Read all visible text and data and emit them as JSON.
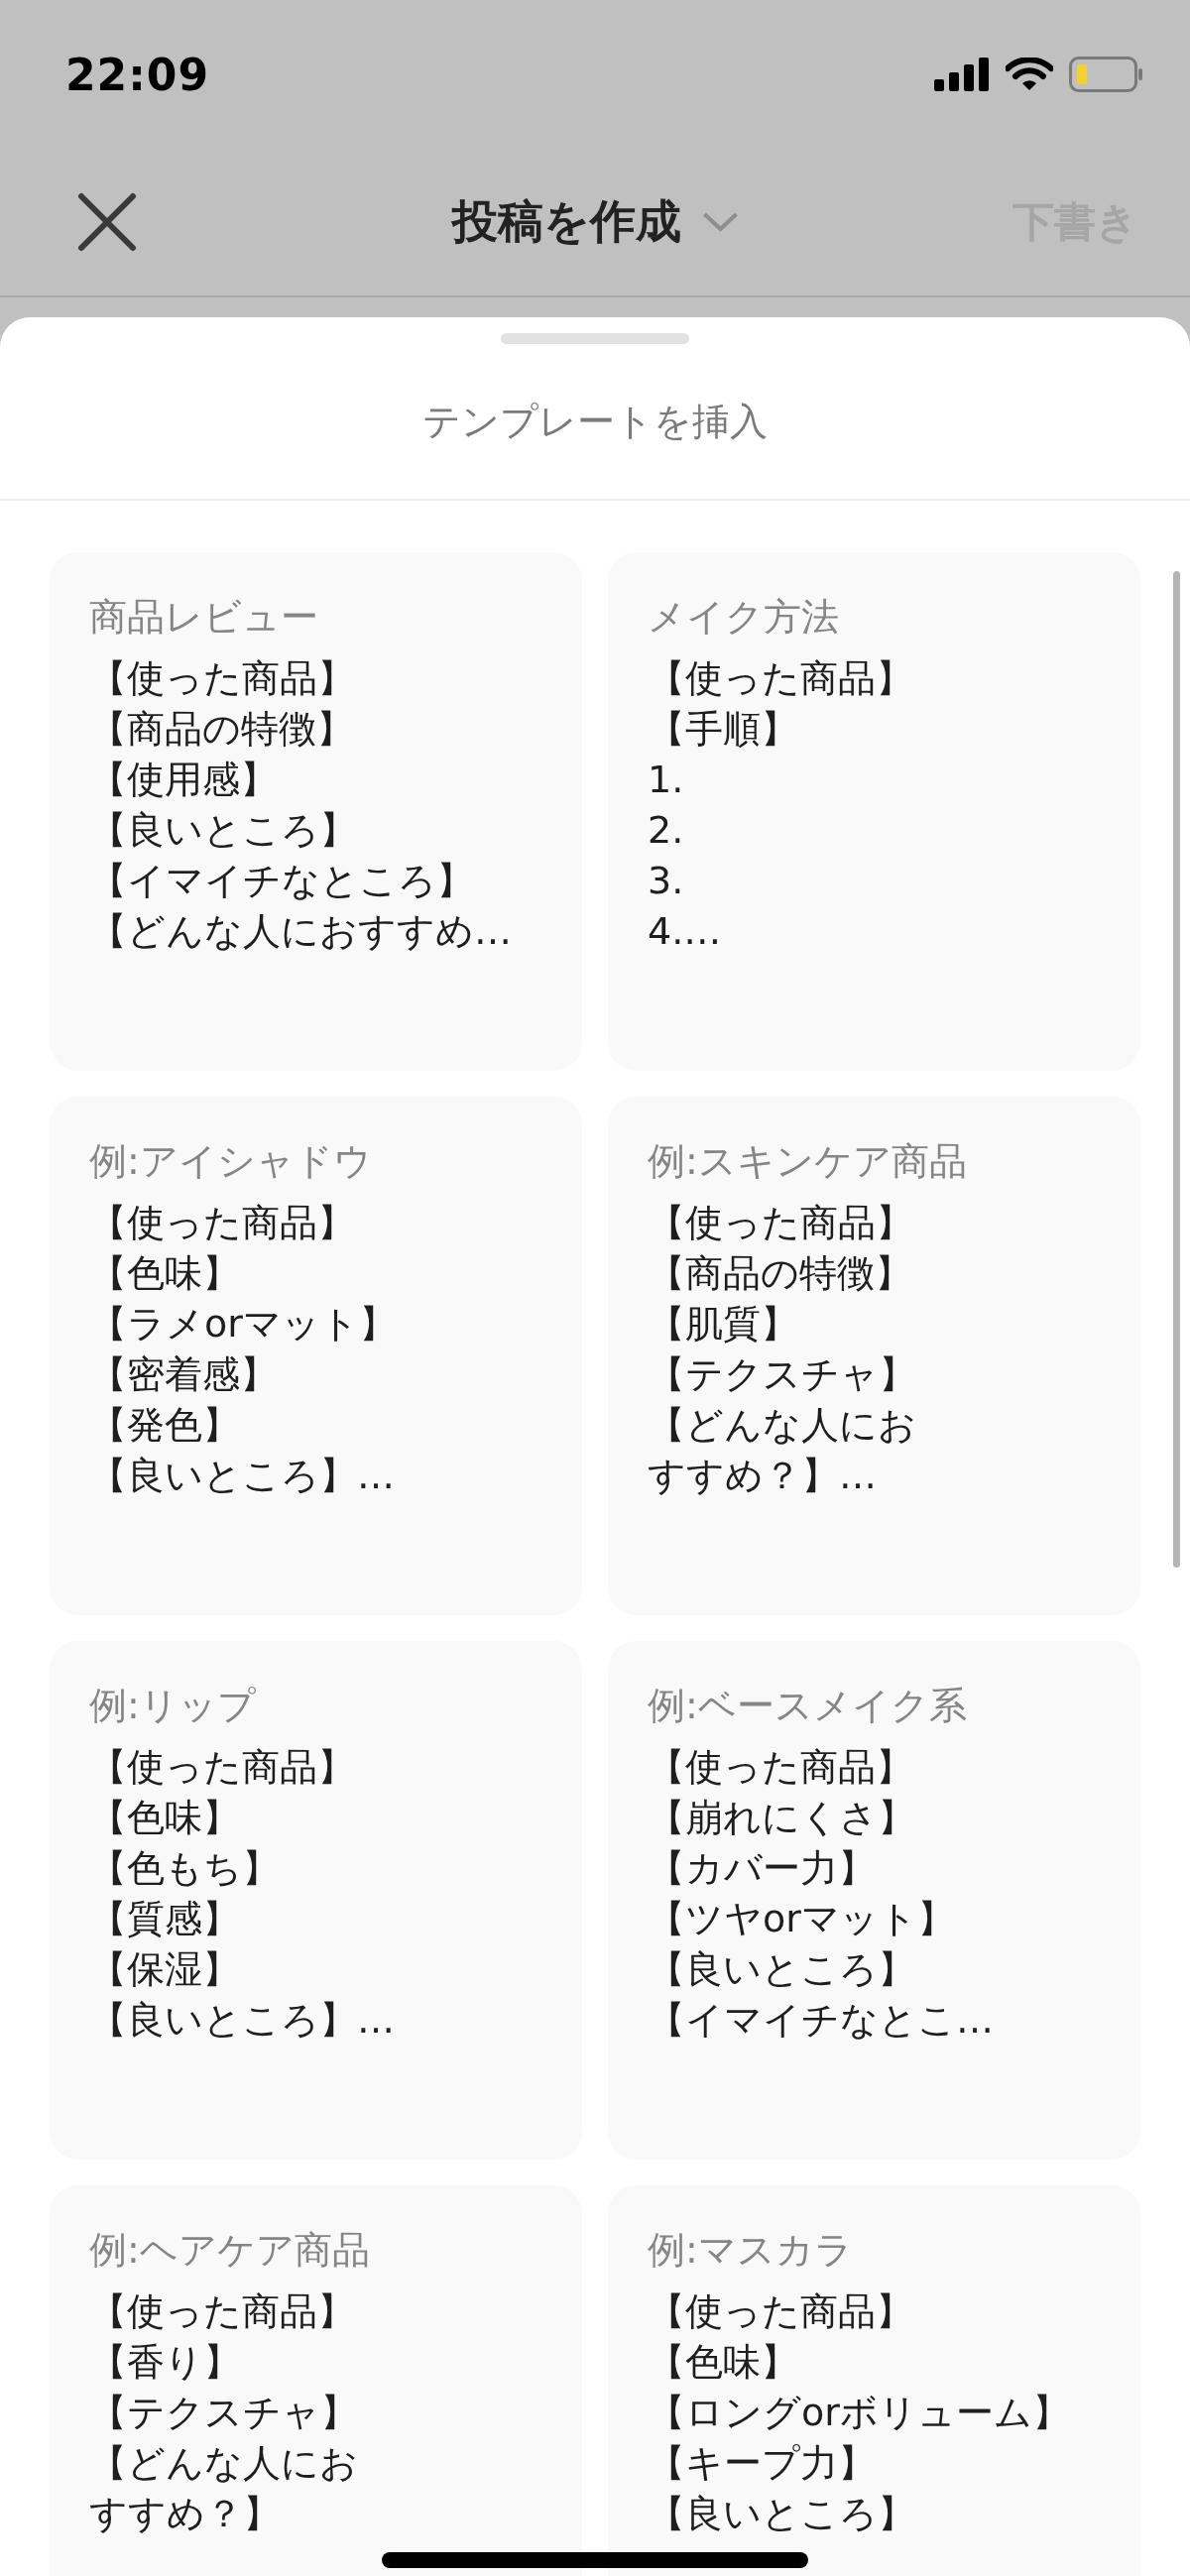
{
  "status_bar": {
    "time": "22:09"
  },
  "nav": {
    "title": "投稿を作成",
    "draft": {
      "label": "下書き",
      "disabled": true
    }
  },
  "sheet": {
    "title": "テンプレートを挿入"
  },
  "templates": [
    {
      "title": "商品レビュー",
      "lines": [
        "【使った商品】",
        "【商品の特徴】",
        "【使用感】",
        "【良いところ】",
        "【イマイチなところ】",
        "【どんな人におすすめ…"
      ]
    },
    {
      "title": "メイク方法",
      "lines": [
        "【使った商品】",
        "【手順】",
        "1.",
        "2.",
        "3.",
        "4.…"
      ]
    },
    {
      "title": "例:アイシャドウ",
      "lines": [
        "【使った商品】",
        "【色味】",
        "【ラメorマット】",
        "【密着感】",
        "【発色】",
        "【良いところ】…"
      ]
    },
    {
      "title": "例:スキンケア商品",
      "lines": [
        "【使った商品】",
        "【商品の特徴】",
        "【肌質】",
        "【テクスチャ】",
        "【どんな人にお",
        "すすめ？】…"
      ]
    },
    {
      "title": "例:リップ",
      "lines": [
        "【使った商品】",
        "【色味】",
        "【色もち】",
        "【質感】",
        "【保湿】",
        "【良いところ】…"
      ]
    },
    {
      "title": "例:ベースメイク系",
      "lines": [
        "【使った商品】",
        "【崩れにくさ】",
        "【カバー力】",
        "【ツヤorマット】",
        "【良いところ】",
        "【イマイチなとこ…"
      ]
    },
    {
      "title": "例:ヘアケア商品",
      "lines": [
        "【使った商品】",
        "【香り】",
        "【テクスチャ】",
        "【どんな人にお",
        "すすめ？】"
      ]
    },
    {
      "title": "例:マスカラ",
      "lines": [
        "【使った商品】",
        "【色味】",
        "【ロングorボリューム】",
        "【キープ力】",
        "【良いところ】"
      ]
    }
  ]
}
